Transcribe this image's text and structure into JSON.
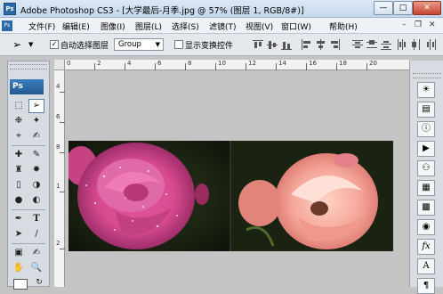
{
  "window": {
    "title": "Adobe Photoshop CS3 - [大学最后-月季.jpg @ 57% (图层 1, RGB/8#)]"
  },
  "menu": [
    "文件(F)",
    "编辑(E)",
    "图像(I)",
    "图层(L)",
    "选择(S)",
    "滤镜(T)",
    "视图(V)",
    "窗口(W)",
    "帮助(H)"
  ],
  "options": {
    "auto_select_label": "自动选择图层",
    "auto_select_checked": true,
    "group_value": "Group",
    "show_transform_label": "显示变换控件",
    "show_transform_checked": false
  },
  "toolbox": {
    "badge": "Ps"
  },
  "ruler": {
    "top_labels": [
      "0",
      "2",
      "4",
      "6",
      "8",
      "10",
      "12",
      "14",
      "16",
      "18",
      "20"
    ],
    "left_labels": [
      "4",
      "6",
      "8",
      "1",
      "2"
    ]
  },
  "colors": {
    "title_bar": "#c5d8ec",
    "ps_blue": "#2b6aa8",
    "canvas_bg": "#c4c4c4"
  }
}
